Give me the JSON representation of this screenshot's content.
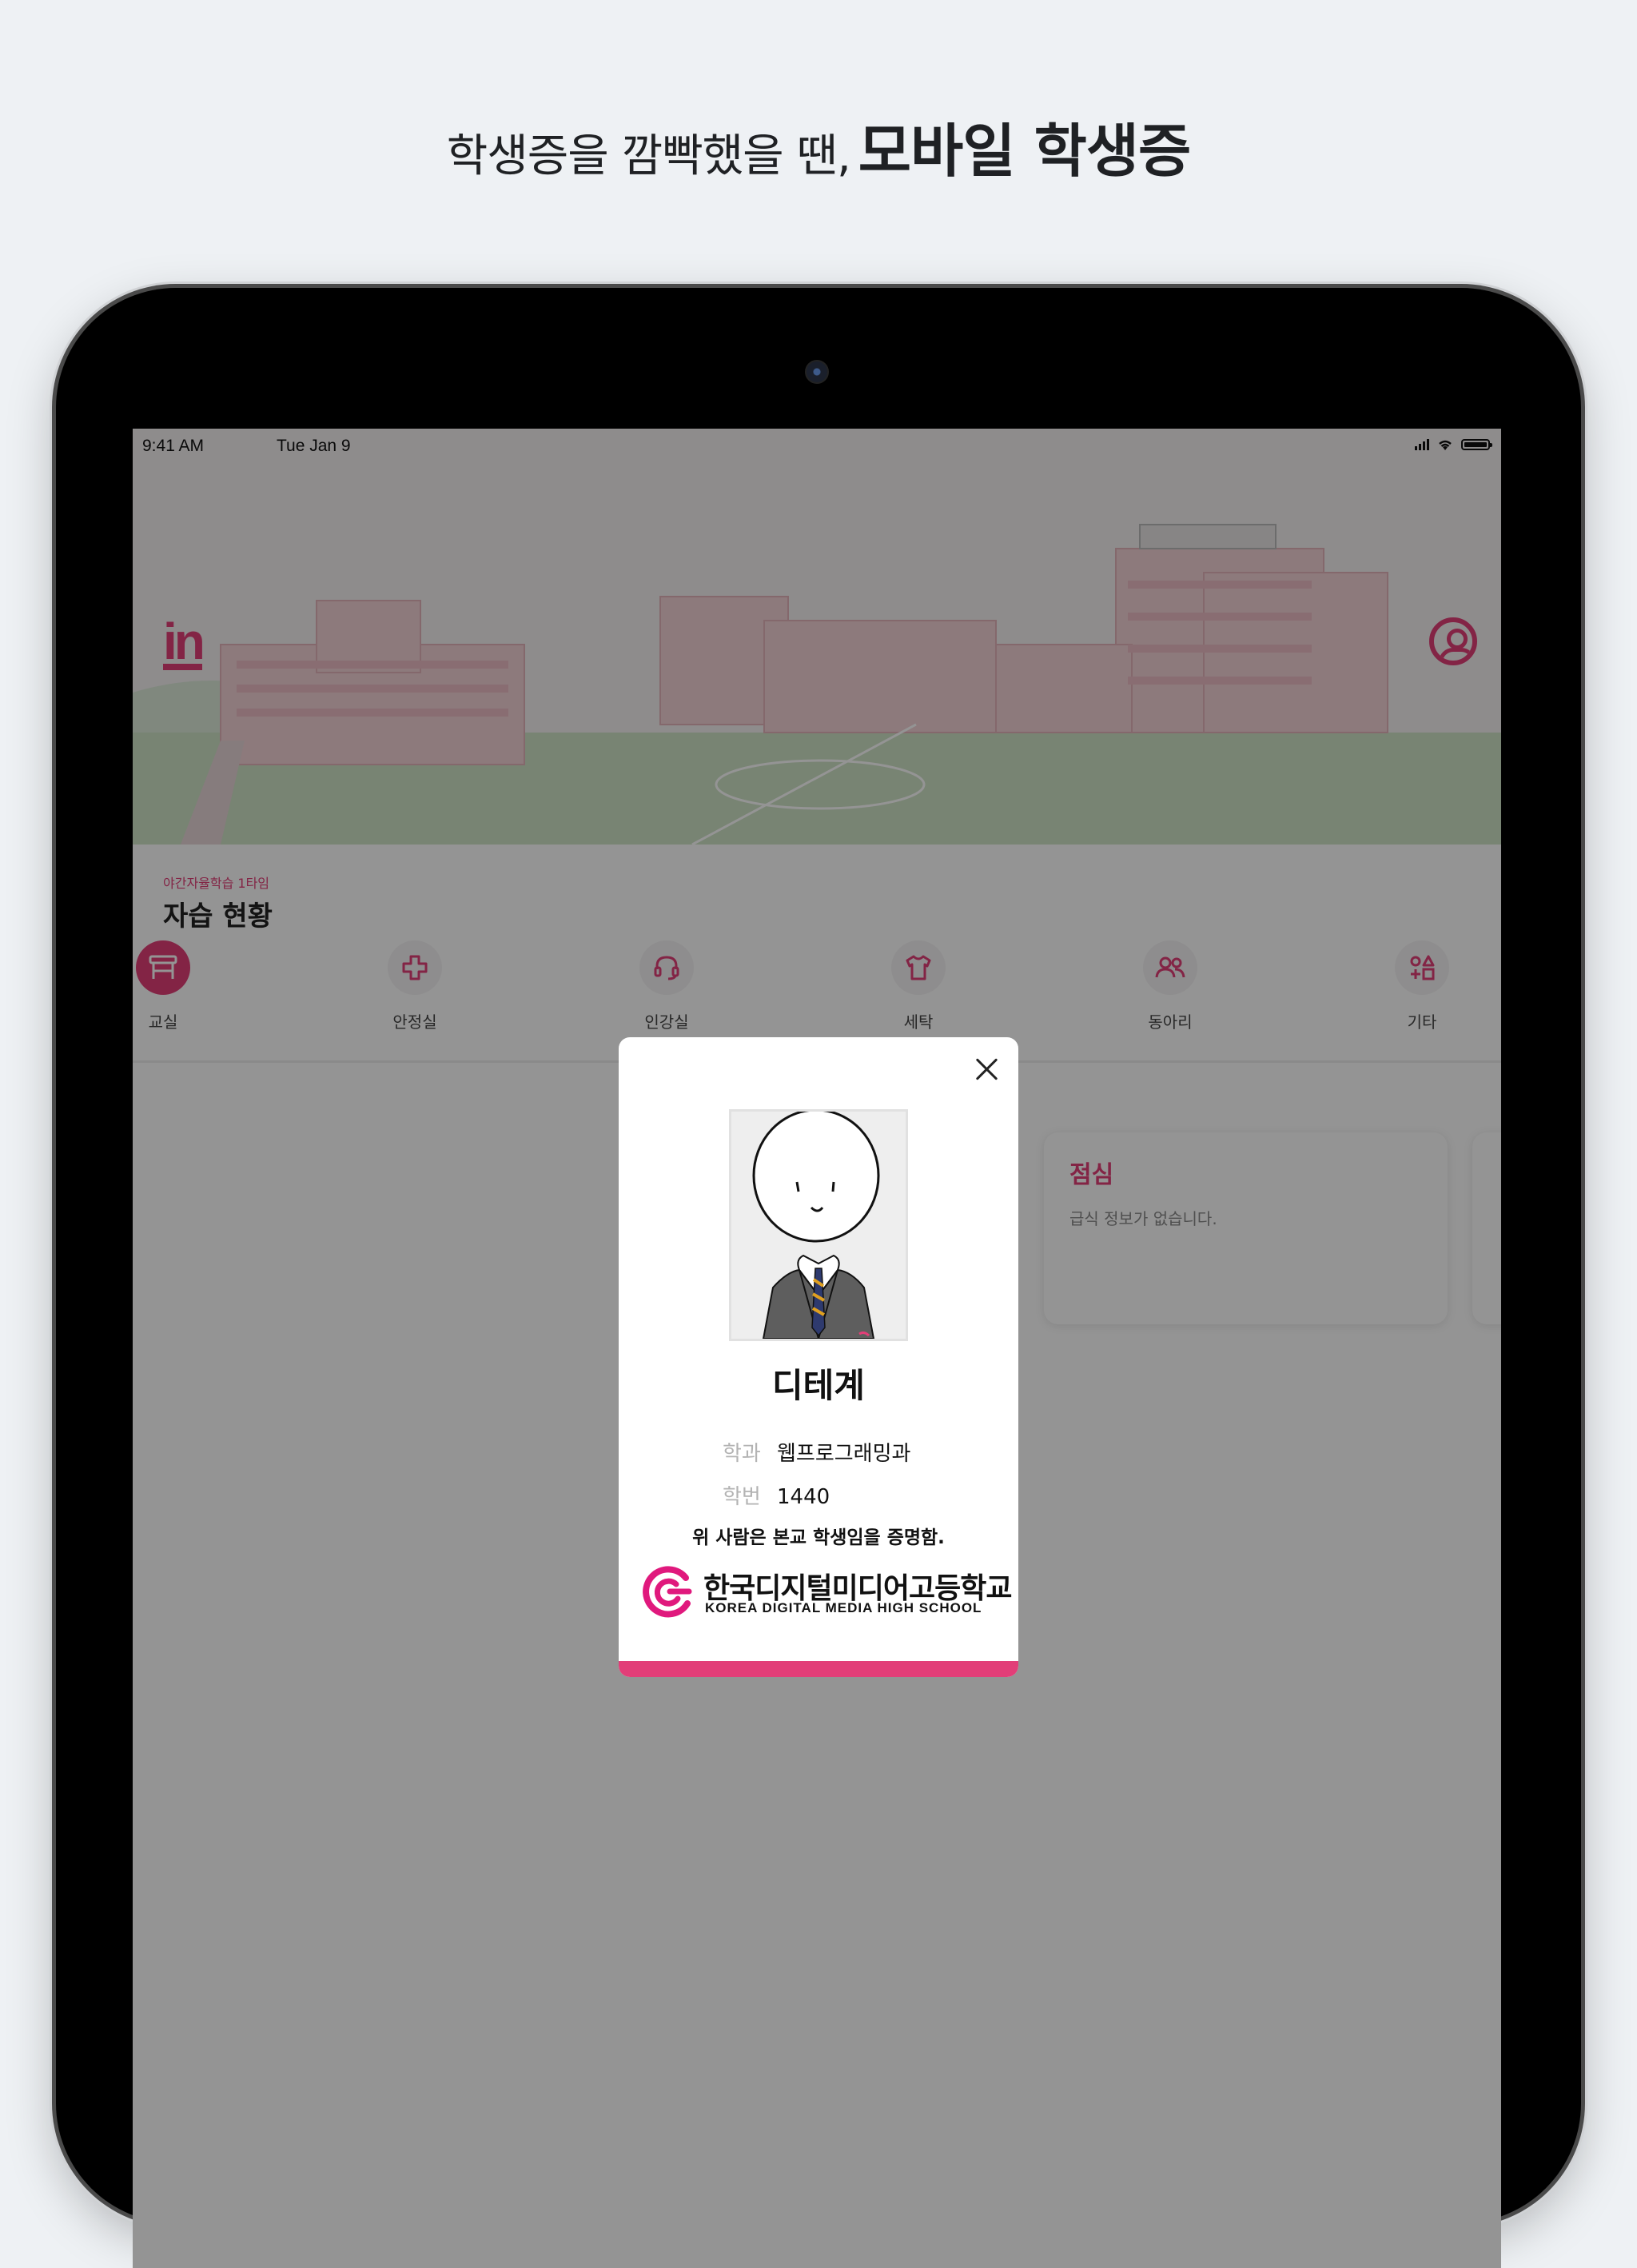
{
  "headline": {
    "normal": "학생증을 깜빡했을 땐,",
    "bold": "모바일 학생증"
  },
  "status_bar": {
    "time": "9:41 AM",
    "date": "Tue Jan 9"
  },
  "app": {
    "logo": "in",
    "subtitle": "야간자율학습 1타임",
    "section_title": "자습 현황",
    "tabs": [
      {
        "label": "교실",
        "icon": "desk-icon",
        "active": true
      },
      {
        "label": "안정실",
        "icon": "medical-cross-icon"
      },
      {
        "label": "인강실",
        "icon": "headset-icon"
      },
      {
        "label": "세탁",
        "icon": "shirt-icon"
      },
      {
        "label": "동아리",
        "icon": "people-icon"
      },
      {
        "label": "기타",
        "icon": "shapes-icon"
      }
    ],
    "meal_card": {
      "title": "점심",
      "text": "급식 정보가 없습니다."
    }
  },
  "student_card": {
    "name": "디테계",
    "department_label": "학과",
    "department": "웹프로그래밍과",
    "student_no_label": "학번",
    "student_no": "1440",
    "certification": "위 사람은 본교 학생임을 증명함.",
    "school_name_ko": "한국디지털미디어고등학교",
    "school_name_en": "KOREA DIGITAL MEDIA HIGH SCHOOL"
  },
  "colors": {
    "accent": "#e23e78",
    "text": "#111111",
    "muted": "#b3b3b3"
  }
}
